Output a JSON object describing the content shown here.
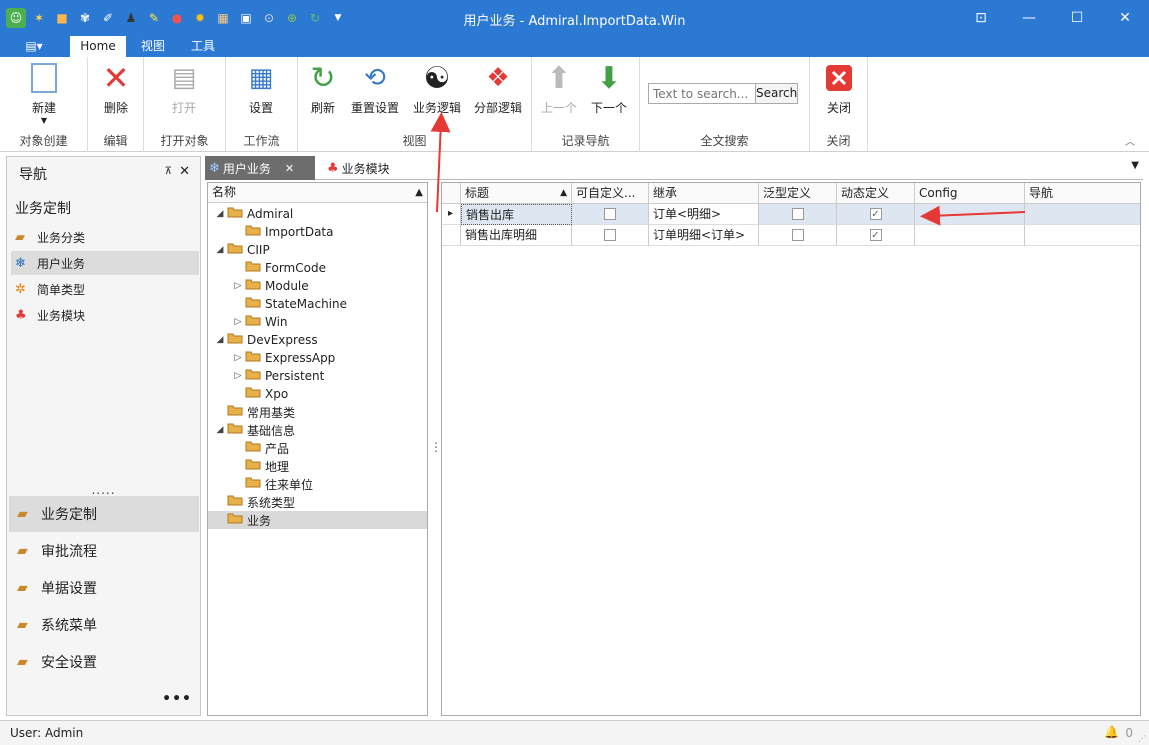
{
  "app": {
    "title": "用户业务 - Admiral.ImportData.Win"
  },
  "tabs": {
    "app_menu": "▤▾",
    "home": "Home",
    "view": "视图",
    "tools": "工具"
  },
  "ribbon": {
    "create": {
      "new": "新建",
      "group": "对象创建"
    },
    "edit": {
      "delete": "删除",
      "group": "编辑"
    },
    "open": {
      "open": "打开",
      "group": "打开对象"
    },
    "workflow": {
      "settings": "设置",
      "group": "工作流"
    },
    "view": {
      "refresh": "刷新",
      "reset": "重置设置",
      "biz_logic": "业务逻辑",
      "sub_logic": "分部逻辑",
      "group": "视图"
    },
    "record_nav": {
      "prev": "上一个",
      "next": "下一个",
      "group": "记录导航"
    },
    "search": {
      "placeholder": "Text to search...",
      "button": "Search",
      "group": "全文搜索"
    },
    "close": {
      "close": "关闭",
      "group": "关闭"
    }
  },
  "nav": {
    "title": "导航",
    "pin": "⊼",
    "close": "✕",
    "section": "业务定制",
    "items": [
      "业务分类",
      "用户业务",
      "简单类型",
      "业务模块"
    ],
    "splitter": ".....",
    "groups": [
      "业务定制",
      "审批流程",
      "单据设置",
      "系统菜单",
      "安全设置"
    ],
    "more": "•••"
  },
  "doc_tabs": {
    "active": "用户业务",
    "other": "业务模块",
    "close": "✕"
  },
  "tree": {
    "header": "名称",
    "nodes": [
      {
        "label": "Admiral",
        "level": 0,
        "exp": "◢"
      },
      {
        "label": "ImportData",
        "level": 1,
        "exp": ""
      },
      {
        "label": "CIIP",
        "level": 0,
        "exp": "◢"
      },
      {
        "label": "FormCode",
        "level": 1,
        "exp": ""
      },
      {
        "label": "Module",
        "level": 1,
        "exp": "▷"
      },
      {
        "label": "StateMachine",
        "level": 1,
        "exp": ""
      },
      {
        "label": "Win",
        "level": 1,
        "exp": "▷"
      },
      {
        "label": "DevExpress",
        "level": 0,
        "exp": "◢"
      },
      {
        "label": "ExpressApp",
        "level": 1,
        "exp": "▷"
      },
      {
        "label": "Persistent",
        "level": 1,
        "exp": "▷"
      },
      {
        "label": "Xpo",
        "level": 1,
        "exp": ""
      },
      {
        "label": "常用基类",
        "level": 0,
        "exp": ""
      },
      {
        "label": "基础信息",
        "level": 0,
        "exp": "◢"
      },
      {
        "label": "产品",
        "level": 1,
        "exp": ""
      },
      {
        "label": "地理",
        "level": 1,
        "exp": ""
      },
      {
        "label": "往来单位",
        "level": 1,
        "exp": ""
      },
      {
        "label": "系统类型",
        "level": 0,
        "exp": ""
      },
      {
        "label": "业务",
        "level": 0,
        "exp": ""
      }
    ]
  },
  "grid": {
    "columns": [
      "标题",
      "可自定义...",
      "继承",
      "泛型定义",
      "动态定义",
      "Config",
      "导航"
    ],
    "rows": [
      {
        "indicator": "▸",
        "title": "销售出库",
        "custom": false,
        "inherit": "订单<明细>",
        "generic": false,
        "dynamic": true,
        "config": "",
        "nav": ""
      },
      {
        "indicator": "",
        "title": "销售出库明细",
        "custom": false,
        "inherit": "订单明细<订单>",
        "generic": false,
        "dynamic": true,
        "config": "",
        "nav": ""
      }
    ]
  },
  "status": {
    "user": "User: Admin",
    "notifications": "0",
    "bell": "🔔",
    "grip": "⋰"
  },
  "colors": {
    "accent": "#2b79d3",
    "selection": "#dde6f1",
    "arrow": "#e53935"
  },
  "icons": {
    "qat": [
      "user-icon",
      "ribbon-icon",
      "gear-icon",
      "bug-icon",
      "flow-icon",
      "person-icon",
      "pen-icon",
      "stop-icon",
      "settings-icon",
      "report-icon",
      "window-icon",
      "up-icon",
      "down-icon",
      "refresh-icon",
      "dropdown-icon"
    ]
  }
}
